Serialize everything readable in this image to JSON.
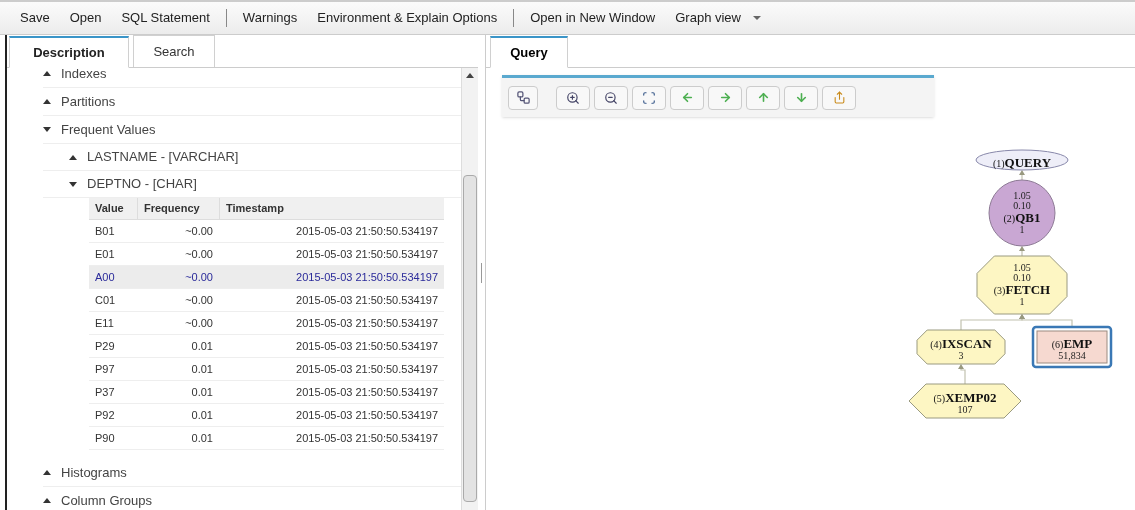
{
  "menu": [
    {
      "kind": "item",
      "label": "Save"
    },
    {
      "kind": "item",
      "label": "Open"
    },
    {
      "kind": "item",
      "label": "SQL Statement"
    },
    {
      "kind": "separator"
    },
    {
      "kind": "item",
      "label": "Warnings"
    },
    {
      "kind": "item",
      "label": "Environment & Explain Options"
    },
    {
      "kind": "separator"
    },
    {
      "kind": "item",
      "label": "Open in New Window"
    },
    {
      "kind": "dropdown",
      "label": "Graph view"
    }
  ],
  "left_tabs": [
    {
      "label": "Description",
      "selected": true
    },
    {
      "label": "Search",
      "selected": false
    }
  ],
  "tree": [
    {
      "label": "Indexes",
      "expanded": false
    },
    {
      "label": "Partitions",
      "expanded": false
    },
    {
      "label": "Frequent Values",
      "expanded": true,
      "children": [
        {
          "label": "LASTNAME - [VARCHAR]",
          "expanded": false
        },
        {
          "label": "DEPTNO - [CHAR]",
          "expanded": true,
          "table": {
            "columns": [
              "Value",
              "Frequency",
              "Timestamp"
            ],
            "rows": [
              {
                "cells": [
                  "B01",
                  "~0.00",
                  "2015-05-03 21:50:50.534197"
                ],
                "selected": false
              },
              {
                "cells": [
                  "E01",
                  "~0.00",
                  "2015-05-03 21:50:50.534197"
                ],
                "selected": false
              },
              {
                "cells": [
                  "A00",
                  "~0.00",
                  "2015-05-03 21:50:50.534197"
                ],
                "selected": true
              },
              {
                "cells": [
                  "C01",
                  "~0.00",
                  "2015-05-03 21:50:50.534197"
                ],
                "selected": false
              },
              {
                "cells": [
                  "E11",
                  "~0.00",
                  "2015-05-03 21:50:50.534197"
                ],
                "selected": false
              },
              {
                "cells": [
                  "P29",
                  "0.01",
                  "2015-05-03 21:50:50.534197"
                ],
                "selected": false
              },
              {
                "cells": [
                  "P97",
                  "0.01",
                  "2015-05-03 21:50:50.534197"
                ],
                "selected": false
              },
              {
                "cells": [
                  "P37",
                  "0.01",
                  "2015-05-03 21:50:50.534197"
                ],
                "selected": false
              },
              {
                "cells": [
                  "P92",
                  "0.01",
                  "2015-05-03 21:50:50.534197"
                ],
                "selected": false
              },
              {
                "cells": [
                  "P90",
                  "0.01",
                  "2015-05-03 21:50:50.534197"
                ],
                "selected": false
              }
            ]
          }
        }
      ]
    },
    {
      "label": "Histograms",
      "expanded": false
    },
    {
      "label": "Column Groups",
      "expanded": false
    }
  ],
  "right_tabs": [
    {
      "label": "Query",
      "selected": true
    }
  ],
  "graph": {
    "number": "(1)",
    "name": "QUERY",
    "kind": "ellipse",
    "selected": false,
    "children": [
      {
        "number": "(2)",
        "name": "QB1",
        "kind": "circle",
        "costs": [
          "1.05",
          "0.10"
        ],
        "rows": "1",
        "selected": false,
        "children": [
          {
            "number": "(3)",
            "name": "FETCH",
            "kind": "octagon",
            "costs": [
              "1.05",
              "0.10"
            ],
            "rows": "1",
            "selected": false,
            "children": [
              {
                "number": "(4)",
                "name": "IXSCAN",
                "kind": "octagon",
                "rows": "3",
                "selected": false,
                "children": [
                  {
                    "number": "(5)",
                    "name": "XEMP02",
                    "kind": "hexagon",
                    "rows": "107",
                    "selected": false
                  }
                ]
              },
              {
                "number": "(6)",
                "name": "EMP",
                "kind": "box",
                "rows": "51,834",
                "selected": true
              }
            ]
          }
        ]
      }
    ]
  }
}
